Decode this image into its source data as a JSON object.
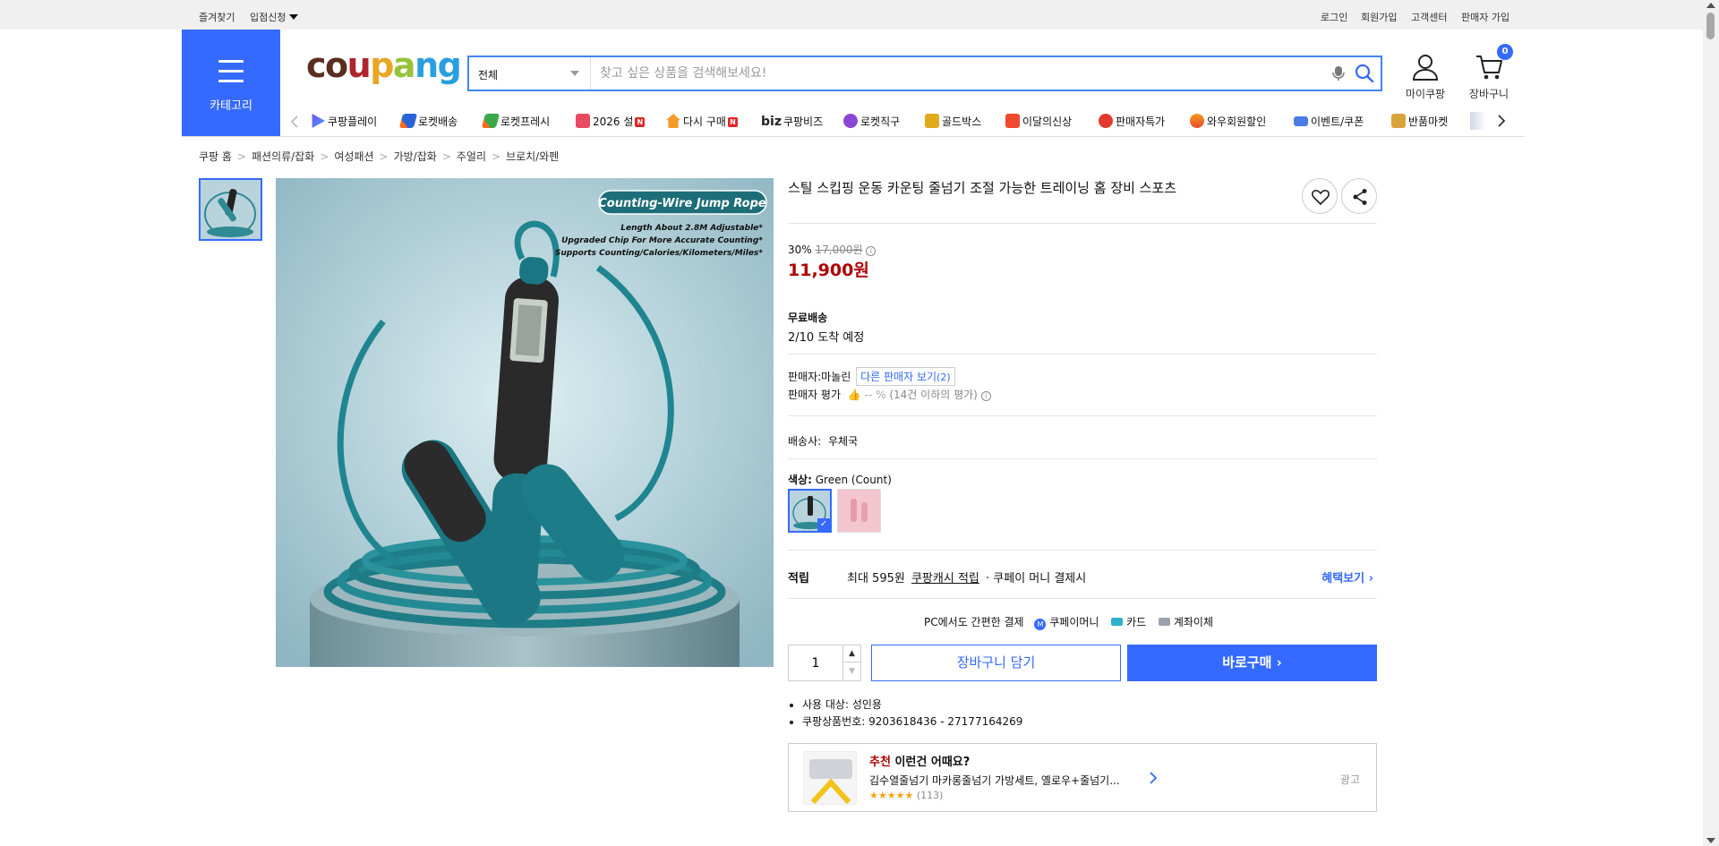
{
  "topbar": {
    "bookmark": "즐겨찾기",
    "seller_apply": "입점신청",
    "login": "로그인",
    "signup": "회원가입",
    "customer_center": "고객센터",
    "seller_signup": "판매자 가입"
  },
  "header": {
    "category_label": "카테고리",
    "logo_text": "coupang",
    "search_category": "전체",
    "search_placeholder": "찾고 싶은 상품을 검색해보세요!",
    "mycoupang": "마이쿠팡",
    "cart": "장바구니",
    "cart_count": "0"
  },
  "nav": [
    {
      "label": "쿠팡플레이",
      "icon": "play-icon"
    },
    {
      "label": "로켓배송",
      "icon": "rocket-icon"
    },
    {
      "label": "로켓프레시",
      "icon": "rocket-fresh-icon"
    },
    {
      "label": "2026 설",
      "icon": "gift-icon",
      "badge": "N"
    },
    {
      "label": "다시 구매",
      "icon": "home-icon",
      "badge": "N"
    },
    {
      "label": "쿠팡비즈",
      "icon": "biz-icon",
      "prefix": "biz"
    },
    {
      "label": "로켓직구",
      "icon": "global-icon"
    },
    {
      "label": "골드박스",
      "icon": "goldbox-icon"
    },
    {
      "label": "이달의신상",
      "icon": "new-icon"
    },
    {
      "label": "판매자특가",
      "icon": "percent-icon"
    },
    {
      "label": "와우회원할인",
      "icon": "wow-icon"
    },
    {
      "label": "이벤트/쿠폰",
      "icon": "coupon-icon"
    },
    {
      "label": "반품마켓",
      "icon": "market-icon"
    }
  ],
  "breadcrumb": [
    "쿠팡 홈",
    "패션의류/잡화",
    "여성패션",
    "가방/잡화",
    "주얼리",
    "브로치/와펜"
  ],
  "product": {
    "title": "스틸 스킵핑 운동 카운팅 줄넘기 조절 가능한 트레이닝 홈 장비 스포츠",
    "image_banner": "Counting-Wire Jump Rope",
    "image_lines": [
      "Length About 2.8M Adjustable*",
      "Upgraded Chip For More Accurate Counting*",
      "Supports Counting/Calories/Kilometers/Miles*"
    ],
    "discount_rate": "30%",
    "original_price": "17,000원",
    "sale_price": "11,900원",
    "shipping_title": "무료배송",
    "arrival": "2/10 도착 예정",
    "seller_label": "판매자:",
    "seller_name": "마놀린",
    "other_sellers": "다른 판매자 보기",
    "other_sellers_count": "(2)",
    "seller_rating_label": "판매자 평가",
    "seller_rating_value": "-- %",
    "seller_rating_note": "(14건 이하의 평가)",
    "carrier_label": "배송사:",
    "carrier": "우체국",
    "color_label": "색상:",
    "color_value": "Green (Count)",
    "reward_label": "적립",
    "reward_text_1": "최대 595원",
    "reward_link": "쿠팡캐시 적립",
    "reward_text_2": "· 쿠페이 머니 결제시",
    "benefit_link": "혜택보기",
    "pay_title": "PC에서도 간편한 결제",
    "pay_methods": [
      "쿠페이머니",
      "카드",
      "계좌이체"
    ],
    "quantity": "1",
    "add_cart": "장바구니 담기",
    "buy_now": "바로구매",
    "bullets": [
      "사용 대상: 성인용",
      "쿠팡상품번호: 9203618436 - 27177164269"
    ]
  },
  "recommend": {
    "tag": "추천",
    "title": "이런건 어때요?",
    "name": "김수열줄넘기 마카롱줄넘기 가방세트, 옐로우+줄넘기...",
    "reviews": "(113)",
    "ad": "광고"
  },
  "colors": {
    "brand_blue": "#346aff",
    "price_red": "#ae0000"
  }
}
